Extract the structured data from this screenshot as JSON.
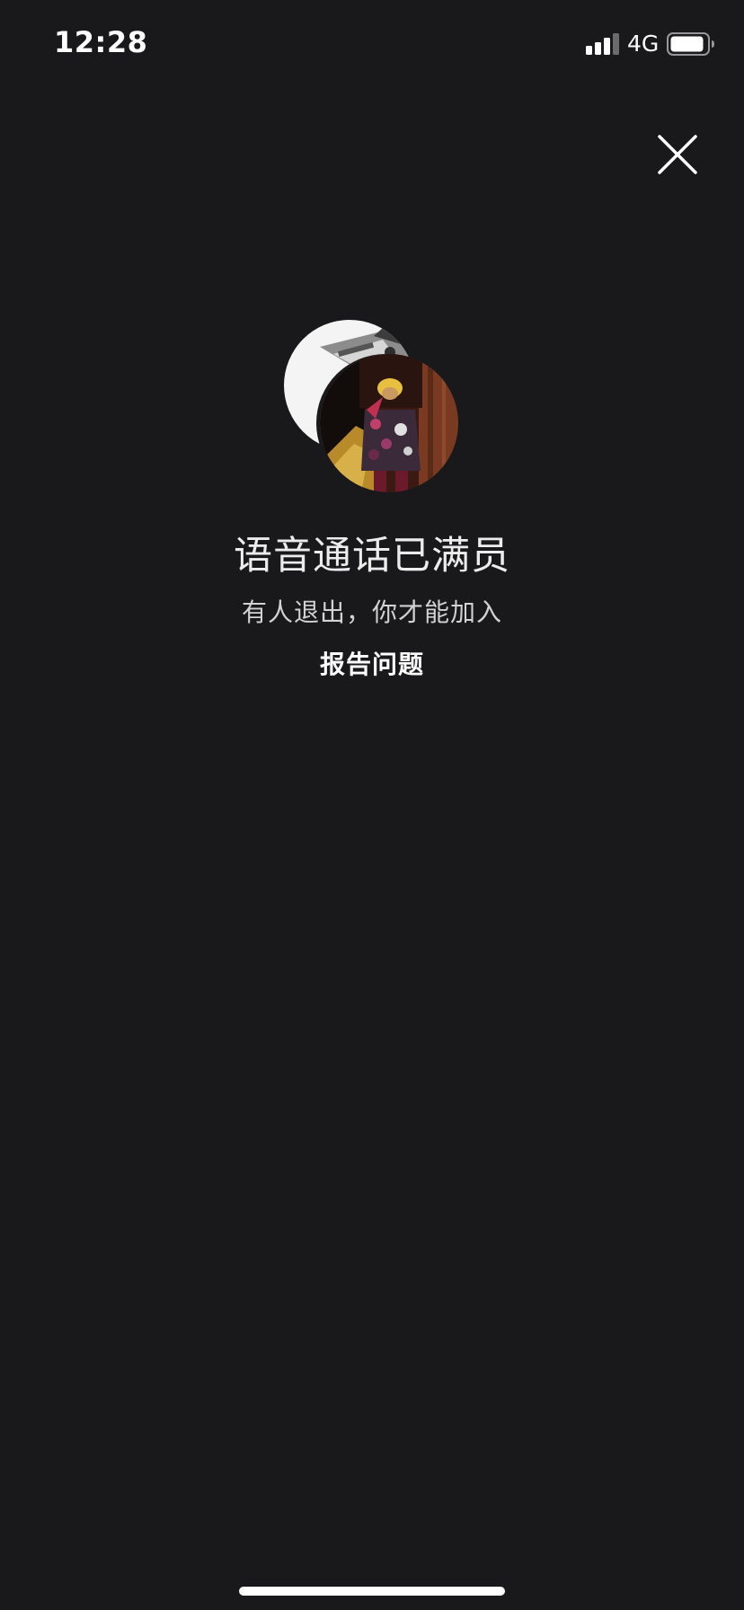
{
  "status_bar": {
    "time": "12:28",
    "network": "4G",
    "signal_icon": "cellular-signal-icon",
    "battery_icon": "battery-icon"
  },
  "close": {
    "icon": "close-icon"
  },
  "call_full": {
    "title": "语音通话已满员",
    "subtitle": "有人退出，你才能加入",
    "report_label": "报告问题"
  },
  "colors": {
    "background": "#19191b",
    "text_primary": "#ececec",
    "text_secondary": "#d2d2d2"
  }
}
